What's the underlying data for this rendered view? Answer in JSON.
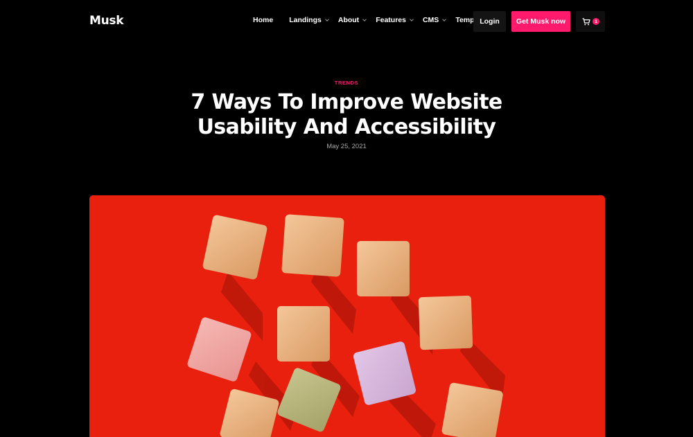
{
  "brand": {
    "logo_text": "Musk"
  },
  "nav": {
    "items": [
      {
        "label": "Home",
        "has_dropdown": false
      },
      {
        "label": "Landings",
        "has_dropdown": true
      },
      {
        "label": "About",
        "has_dropdown": true
      },
      {
        "label": "Features",
        "has_dropdown": true
      },
      {
        "label": "CMS",
        "has_dropdown": true
      },
      {
        "label": "Template",
        "has_dropdown": true
      }
    ],
    "login_label": "Login",
    "cta_label": "Get Musk now",
    "cart_icon": "cart-icon",
    "cart_count": "1"
  },
  "article": {
    "category": "TRENDS",
    "title_line1": "7 Ways To Improve Website",
    "title_line2": "Usability And Accessibility",
    "date": "May 25, 2021"
  },
  "colors": {
    "background": "#000000",
    "accent": "#ff1a6c",
    "hero_background": "#e8200d"
  }
}
